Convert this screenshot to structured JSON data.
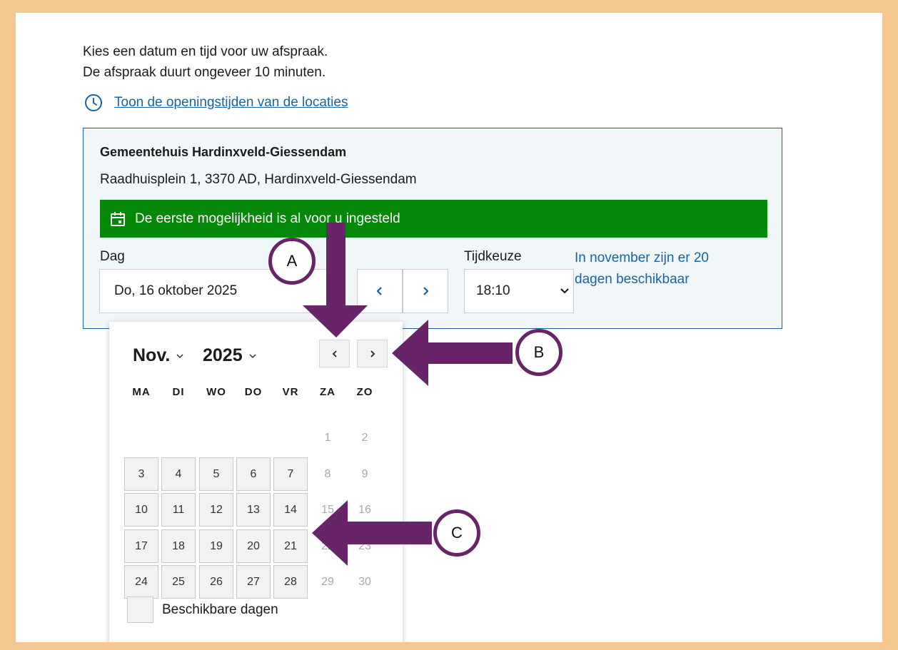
{
  "intro": {
    "line1": "Kies een datum en tijd voor uw afspraak.",
    "line2": "De afspraak duurt ongeveer 10 minuten."
  },
  "hours_link": {
    "icon": "clock-icon",
    "label": "Toon de openingstijden van de locaties"
  },
  "location": {
    "name": "Gemeentehuis Hardinxveld-Giessendam",
    "address": "Raadhuisplein 1, 3370 AD, Hardinxveld-Giessendam",
    "banner": {
      "icon": "calendar-icon",
      "text": "De eerste mogelijkheid is al voor u ingesteld",
      "color": "#05870a"
    },
    "day_label": "Dag",
    "date_value": "Do, 16 oktober 2025",
    "time_label": "Tijdkeuze",
    "time_value": "18:10",
    "availability_note": "In november zijn er 20 dagen beschikbaar"
  },
  "calendar": {
    "month": "Nov.",
    "year": "2025",
    "weekdays": [
      "MA",
      "DI",
      "WO",
      "DO",
      "VR",
      "ZA",
      "ZO"
    ],
    "weeks": [
      [
        null,
        null,
        null,
        null,
        null,
        {
          "d": "1",
          "a": false
        },
        {
          "d": "2",
          "a": false
        }
      ],
      [
        {
          "d": "3",
          "a": true
        },
        {
          "d": "4",
          "a": true
        },
        {
          "d": "5",
          "a": true
        },
        {
          "d": "6",
          "a": true
        },
        {
          "d": "7",
          "a": true
        },
        {
          "d": "8",
          "a": false
        },
        {
          "d": "9",
          "a": false
        }
      ],
      [
        {
          "d": "10",
          "a": true
        },
        {
          "d": "11",
          "a": true
        },
        {
          "d": "12",
          "a": true
        },
        {
          "d": "13",
          "a": true
        },
        {
          "d": "14",
          "a": true
        },
        {
          "d": "15",
          "a": false
        },
        {
          "d": "16",
          "a": false
        }
      ],
      [
        {
          "d": "17",
          "a": true
        },
        {
          "d": "18",
          "a": true
        },
        {
          "d": "19",
          "a": true
        },
        {
          "d": "20",
          "a": true
        },
        {
          "d": "21",
          "a": true
        },
        {
          "d": "22",
          "a": false
        },
        {
          "d": "23",
          "a": false
        }
      ],
      [
        {
          "d": "24",
          "a": true
        },
        {
          "d": "25",
          "a": true
        },
        {
          "d": "26",
          "a": true
        },
        {
          "d": "27",
          "a": true
        },
        {
          "d": "28",
          "a": true
        },
        {
          "d": "29",
          "a": false
        },
        {
          "d": "30",
          "a": false
        }
      ]
    ],
    "legend": "Beschikbare dagen"
  },
  "annotations": {
    "a": "A",
    "b": "B",
    "c": "C",
    "color": "#682468"
  }
}
